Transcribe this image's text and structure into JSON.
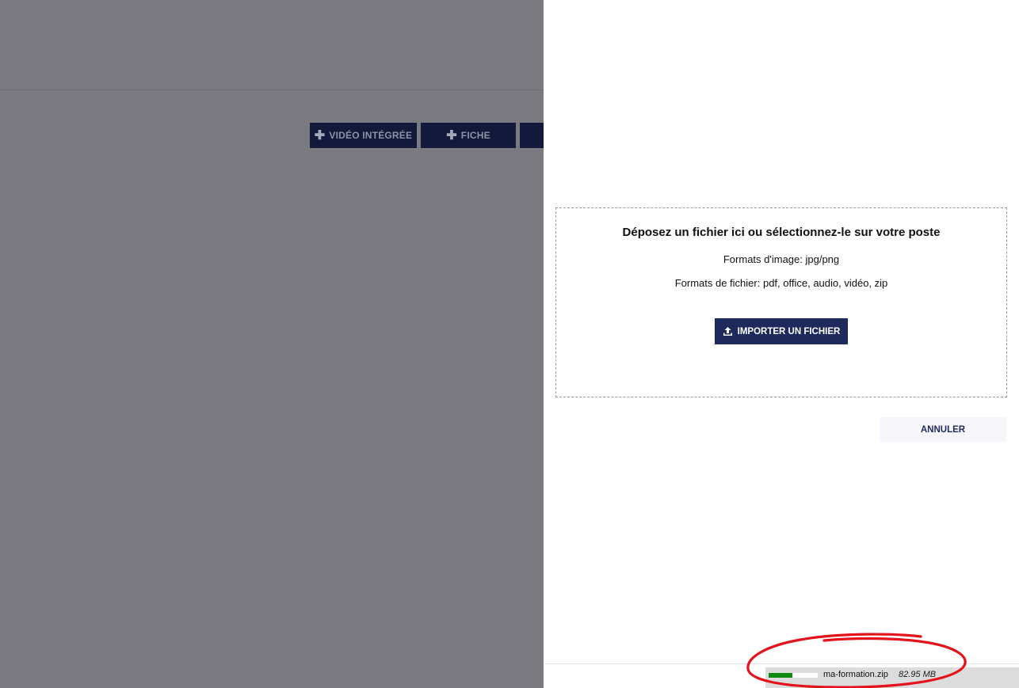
{
  "background": {
    "toolbar_buttons": [
      {
        "icon": "plus-icon",
        "label": "VIDÉO INTÉGRÉE"
      },
      {
        "icon": "plus-icon",
        "label": "FICHE"
      },
      {
        "icon": "",
        "label": ""
      }
    ]
  },
  "upload_panel": {
    "dropzone": {
      "title": "Déposez un fichier ici ou sélectionnez-le sur votre poste",
      "image_formats": "Formats d'image: jpg/png",
      "file_formats": "Formats de fichier: pdf, office, audio, vidéo, zip",
      "import_button": {
        "icon": "upload-icon",
        "label": "IMPORTER UN FICHIER"
      }
    },
    "cancel_button": "ANNULER"
  },
  "upload_status": {
    "file_name": "ma-formation.zip",
    "file_size": "82.95 MB",
    "progress": 0.48,
    "progress_color": "#0f8a10"
  },
  "annotation": {
    "color": "#e3121b"
  },
  "colors": {
    "overlay": "#7b7a80",
    "primary_button": "#1f2a5c",
    "dark_button": "#12193b"
  }
}
